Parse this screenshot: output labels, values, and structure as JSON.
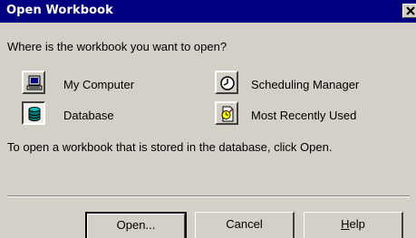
{
  "window": {
    "title": "Open Workbook",
    "close_glyph": "×"
  },
  "prompt": "Where is the workbook you want to open?",
  "options": [
    {
      "label": "My Computer",
      "icon": "computer-icon",
      "selected": false
    },
    {
      "label": "Scheduling Manager",
      "icon": "clock-icon",
      "selected": false
    },
    {
      "label": "Database",
      "icon": "database-icon",
      "selected": true
    },
    {
      "label": "Most Recently Used",
      "icon": "recent-document-icon",
      "selected": false
    }
  ],
  "hint": "To open a workbook that is stored in the database, click Open.",
  "buttons": {
    "open": "Open...",
    "cancel": "Cancel",
    "help_prefix": "",
    "help_mnemonic": "H",
    "help_rest": "elp"
  },
  "colors": {
    "titlebar": "#000080",
    "face": "#d4d0c8",
    "database_icon": "#008080"
  }
}
